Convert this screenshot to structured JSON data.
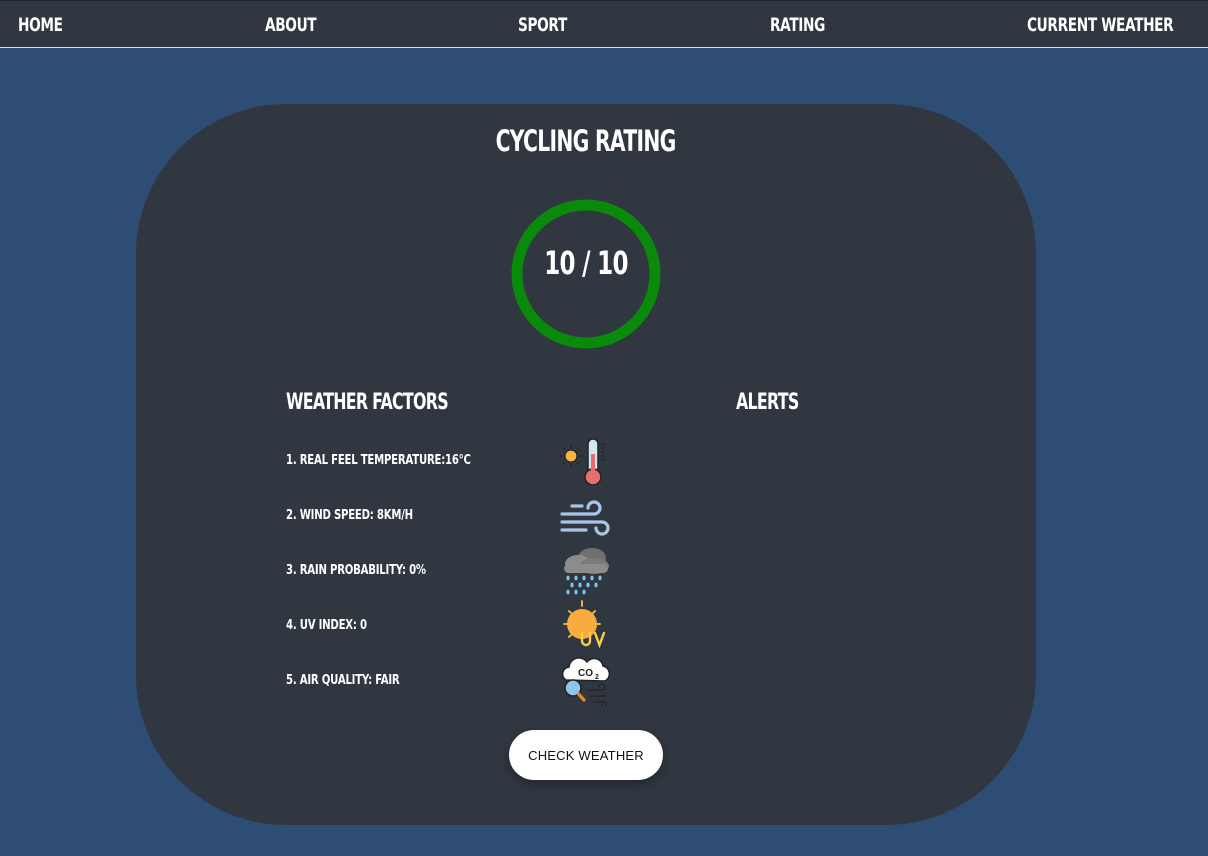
{
  "nav": {
    "items": [
      {
        "label": "HOME"
      },
      {
        "label": "ABOUT"
      },
      {
        "label": "SPORT"
      },
      {
        "label": "RATING"
      },
      {
        "label": "CURRENT WEATHER"
      }
    ]
  },
  "card": {
    "title": "CYCLING RATING",
    "rating": {
      "text": "10 / 10",
      "value": 10,
      "max": 10,
      "ring_color": "#0a8a0a"
    },
    "factors_heading": "WEATHER FACTORS",
    "alerts_heading": "ALERTS",
    "factors": [
      {
        "label": "1. REAL FEEL TEMPERATURE:16°C",
        "icon": "thermometer-sun-icon"
      },
      {
        "label": "2. WIND SPEED: 8KM/H",
        "icon": "wind-icon"
      },
      {
        "label": "3. RAIN PROBABILITY: 0%",
        "icon": "rain-cloud-icon"
      },
      {
        "label": "4. UV INDEX: 0",
        "icon": "uv-sun-icon"
      },
      {
        "label": "5. AIR QUALITY: FAIR",
        "icon": "co2-cloud-icon"
      }
    ],
    "button_label": "CHECK WEATHER"
  },
  "colors": {
    "page_background": "#2e4d75",
    "navbar_background": "#303741",
    "card_background": "#313741",
    "rating_ring": "#0a8a0a",
    "text": "#ffffff"
  }
}
